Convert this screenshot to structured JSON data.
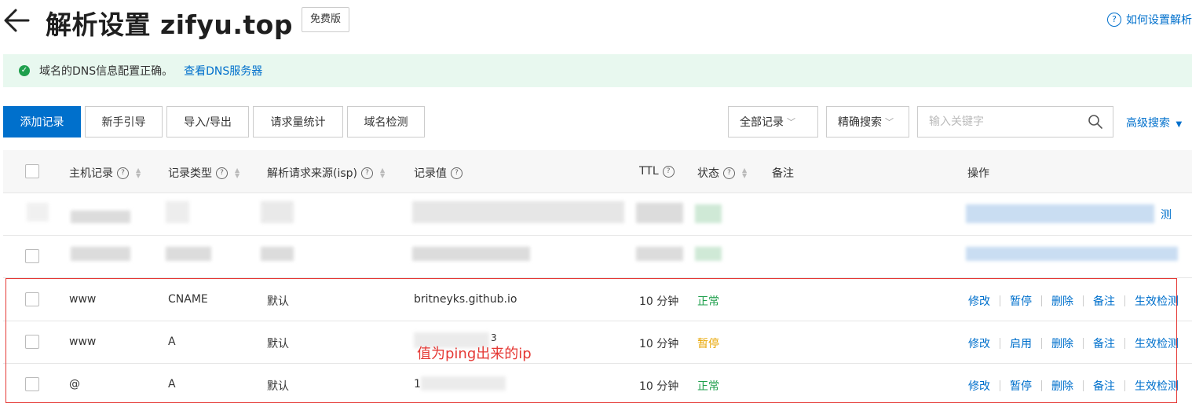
{
  "header": {
    "title": "解析设置 zifyu.top",
    "tag": "免费版",
    "help_link": "如何设置解析"
  },
  "alert": {
    "message": "域名的DNS信息配置正确。",
    "link": "查看DNS服务器"
  },
  "toolbar": {
    "add_record": "添加记录",
    "guide": "新手引导",
    "import_export": "导入/导出",
    "request_stats": "请求量统计",
    "domain_check": "域名检测",
    "filter_all": "全部记录",
    "search_mode": "精确搜索",
    "search_placeholder": "输入关键字",
    "advanced_search": "高级搜索"
  },
  "table": {
    "headers": {
      "host": "主机记录",
      "type": "记录类型",
      "isp": "解析请求来源(isp)",
      "value": "记录值",
      "ttl": "TTL",
      "status": "状态",
      "remark": "备注",
      "actions": "操作"
    },
    "blurred_action_tail": "测",
    "rows": [
      {
        "host": "www",
        "type": "CNAME",
        "isp": "默认",
        "value": "britneyks.github.io",
        "ttl": "10 分钟",
        "status": "正常",
        "actions": [
          "修改",
          "暂停",
          "删除",
          "备注",
          "生效检测"
        ]
      },
      {
        "host": "www",
        "type": "A",
        "isp": "默认",
        "value": "3",
        "ttl": "10 分钟",
        "status": "暂停",
        "actions": [
          "修改",
          "启用",
          "删除",
          "备注",
          "生效检测"
        ]
      },
      {
        "host": "@",
        "type": "A",
        "isp": "默认",
        "value": "1",
        "ttl": "10 分钟",
        "status": "正常",
        "actions": [
          "修改",
          "暂停",
          "删除",
          "备注",
          "生效检测"
        ]
      }
    ]
  },
  "annotation": "值为ping出来的ip",
  "colors": {
    "primary": "#0070cc",
    "success": "#1e9f4c",
    "warning": "#e8a500",
    "annotation": "#e53935",
    "alert_bg": "#e8f8ef"
  }
}
